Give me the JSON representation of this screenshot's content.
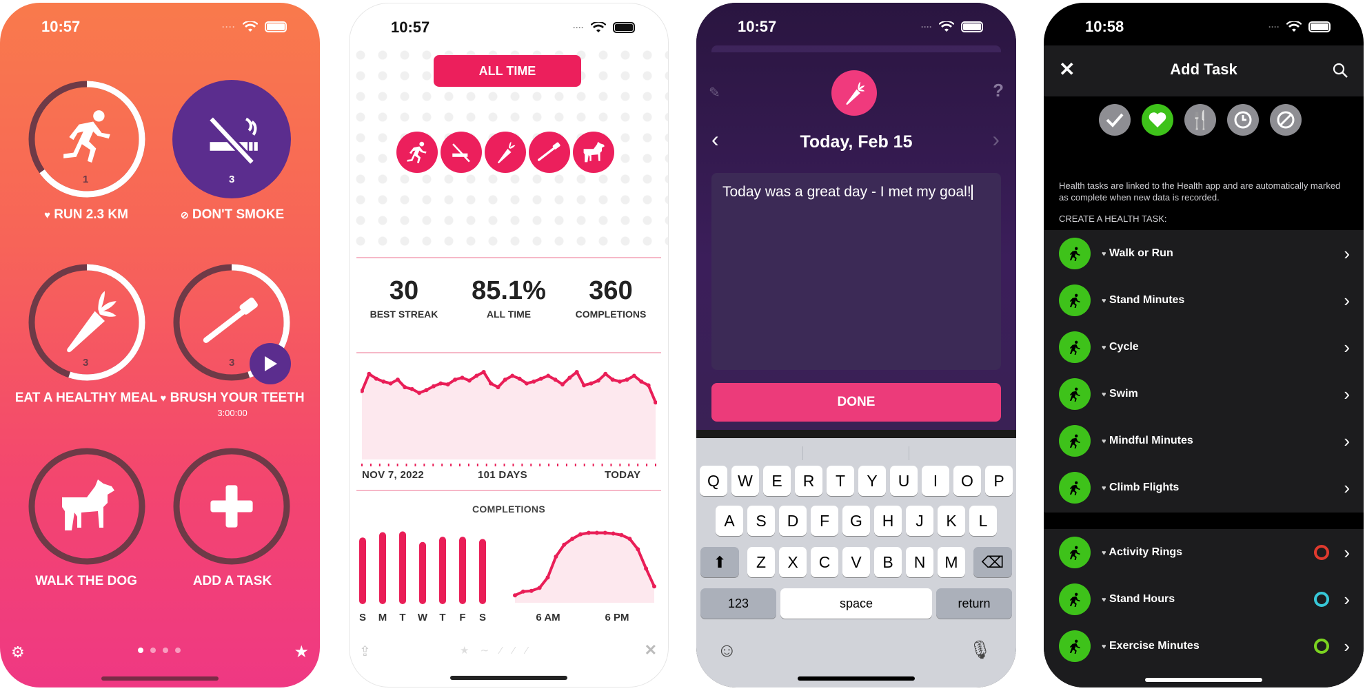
{
  "status_times": [
    "10:57",
    "10:57",
    "10:57",
    "10:58"
  ],
  "phone1": {
    "habits": [
      {
        "label": "RUN 2.3 KM",
        "count": "1",
        "prefix": "heart"
      },
      {
        "label": "DON'T SMOKE",
        "count": "3",
        "prefix": "no"
      },
      {
        "label": "EAT A HEALTHY MEAL",
        "count": "3",
        "prefix": ""
      },
      {
        "label": "BRUSH YOUR TEETH",
        "count": "3",
        "prefix": "heart",
        "sub": "3:00:00"
      },
      {
        "label": "WALK THE DOG",
        "count": "",
        "prefix": ""
      },
      {
        "label": "ADD A TASK",
        "count": "",
        "prefix": ""
      }
    ],
    "progress": [
      0.65,
      1.0,
      0.55,
      0.45,
      0,
      0
    ],
    "colors": {
      "ring_track": "#6b3a49",
      "ring_fill": "#ffffff",
      "smoke_bg": "#5b2d8e"
    }
  },
  "phone2": {
    "all_time_button": "ALL TIME",
    "stats": [
      {
        "value": "30",
        "label": "BEST STREAK"
      },
      {
        "value": "85.1%",
        "label": "ALL TIME"
      },
      {
        "value": "360",
        "label": "COMPLETIONS"
      }
    ],
    "line_start": "NOV 7, 2022",
    "line_mid": "101 DAYS",
    "line_end": "TODAY",
    "completions_title": "COMPLETIONS",
    "weekdays": [
      "S",
      "M",
      "T",
      "W",
      "T",
      "F",
      "S"
    ],
    "time_labels": [
      "6 AM",
      "6 PM"
    ],
    "accent": "#e91e57"
  },
  "chart_data": [
    {
      "type": "line",
      "title": "",
      "x_labels": [
        "NOV 7, 2022",
        "101 DAYS",
        "TODAY"
      ],
      "values": [
        0.72,
        0.9,
        0.85,
        0.82,
        0.8,
        0.84,
        0.76,
        0.74,
        0.7,
        0.73,
        0.77,
        0.8,
        0.79,
        0.84,
        0.86,
        0.83,
        0.88,
        0.92,
        0.8,
        0.76,
        0.84,
        0.88,
        0.85,
        0.8,
        0.82,
        0.85,
        0.88,
        0.84,
        0.79,
        0.86,
        0.92,
        0.78,
        0.8,
        0.83,
        0.9,
        0.84,
        0.82,
        0.84,
        0.88,
        0.82,
        0.78,
        0.6
      ]
    },
    {
      "type": "bar",
      "title": "COMPLETIONS",
      "categories": [
        "S",
        "M",
        "T",
        "W",
        "T",
        "F",
        "S"
      ],
      "values": [
        88,
        95,
        96,
        82,
        89,
        89,
        86
      ],
      "ylim": [
        0,
        100
      ]
    },
    {
      "type": "area",
      "x_labels": [
        "6 AM",
        "6 PM"
      ],
      "values": [
        10,
        15,
        16,
        20,
        34,
        62,
        78,
        86,
        92,
        94,
        94,
        94,
        93,
        91,
        86,
        72,
        46,
        22
      ]
    }
  ],
  "phone3": {
    "title": "Today, Feb 15",
    "note": "Today was a great day - I met my goal!",
    "done": "DONE",
    "help": "?",
    "keys_row1": [
      "Q",
      "W",
      "E",
      "R",
      "T",
      "Y",
      "U",
      "I",
      "O",
      "P"
    ],
    "keys_row2": [
      "A",
      "S",
      "D",
      "F",
      "G",
      "H",
      "J",
      "K",
      "L"
    ],
    "keys_row3": [
      "Z",
      "X",
      "C",
      "V",
      "B",
      "N",
      "M"
    ],
    "key_numbers": "123",
    "key_space": "space",
    "key_return": "return"
  },
  "phone4": {
    "title": "Add Task",
    "info": "Health tasks are linked to the Health app and are automatically marked as complete when new data is recorded.",
    "section": "CREATE A HEALTH TASK:",
    "tasks": [
      "Walk or Run",
      "Stand Minutes",
      "Cycle",
      "Swim",
      "Mindful Minutes",
      "Climb Flights"
    ],
    "tasks2": [
      "Activity Rings",
      "Stand Hours",
      "Exercise Minutes"
    ],
    "green": "#3ec21a"
  },
  "icons": [
    "run-icon",
    "no-smoking-icon",
    "carrot-icon",
    "toothbrush-icon",
    "dog-icon",
    "plus-icon",
    "gear-icon",
    "star-icon",
    "share-icon",
    "close-icon",
    "pin-icon",
    "keyboard-emoji-icon",
    "microphone-icon",
    "search-icon",
    "checkmark-icon",
    "heart-icon",
    "fork-knife-icon",
    "clock-icon",
    "prohibit-icon"
  ]
}
